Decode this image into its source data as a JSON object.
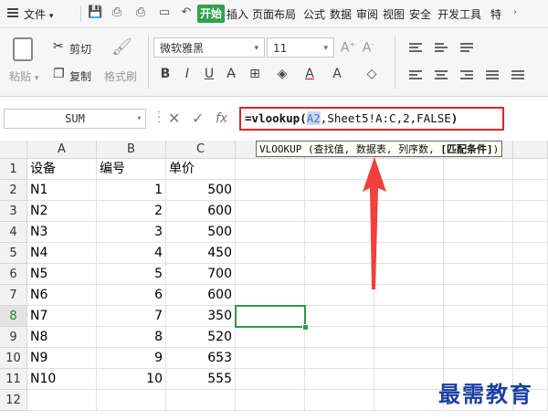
{
  "menu": {
    "file_label": "文件",
    "tabs": [
      "开始",
      "插入",
      "页面布局",
      "公式",
      "数据",
      "审阅",
      "视图",
      "安全",
      "开发工具",
      "特"
    ]
  },
  "ribbon": {
    "paste_label": "粘贴",
    "cut_label": "剪切",
    "copy_label": "复制",
    "format_painter_label": "格式刷",
    "font_name": "微软雅黑",
    "font_size": "11",
    "bold": "B",
    "italic": "I",
    "underline": "U"
  },
  "formula_bar": {
    "name_box": "SUM",
    "formula_prefix": "=vlookup(",
    "formula_ref": "A2",
    "formula_rest": ",Sheet5!A:C,2,FALSE",
    "formula_suffix": ")"
  },
  "tooltip": {
    "text": "VLOOKUP (查找值, 数据表, 列序数, ",
    "bold_text": "[匹配条件]",
    "end": ")"
  },
  "sheet": {
    "columns": [
      "A",
      "B",
      "C"
    ],
    "rows": [
      "1",
      "2",
      "3",
      "4",
      "5",
      "6",
      "7",
      "8",
      "9",
      "10",
      "11",
      "12"
    ],
    "headers": [
      "设备",
      "编号",
      "单价"
    ],
    "data": [
      [
        "N1",
        "1",
        "500"
      ],
      [
        "N2",
        "2",
        "600"
      ],
      [
        "N3",
        "3",
        "500"
      ],
      [
        "N4",
        "4",
        "450"
      ],
      [
        "N5",
        "5",
        "700"
      ],
      [
        "N6",
        "6",
        "600"
      ],
      [
        "N7",
        "7",
        "350"
      ],
      [
        "N8",
        "8",
        "520"
      ],
      [
        "N9",
        "9",
        "653"
      ],
      [
        "N10",
        "10",
        "555"
      ]
    ],
    "active_row": "8"
  },
  "watermark": "最需教育",
  "colors": {
    "accent_green": "#2fa24b",
    "highlight_red": "#e02424",
    "arrow_red": "#f2403b",
    "watermark_blue": "#1b3fa6"
  }
}
